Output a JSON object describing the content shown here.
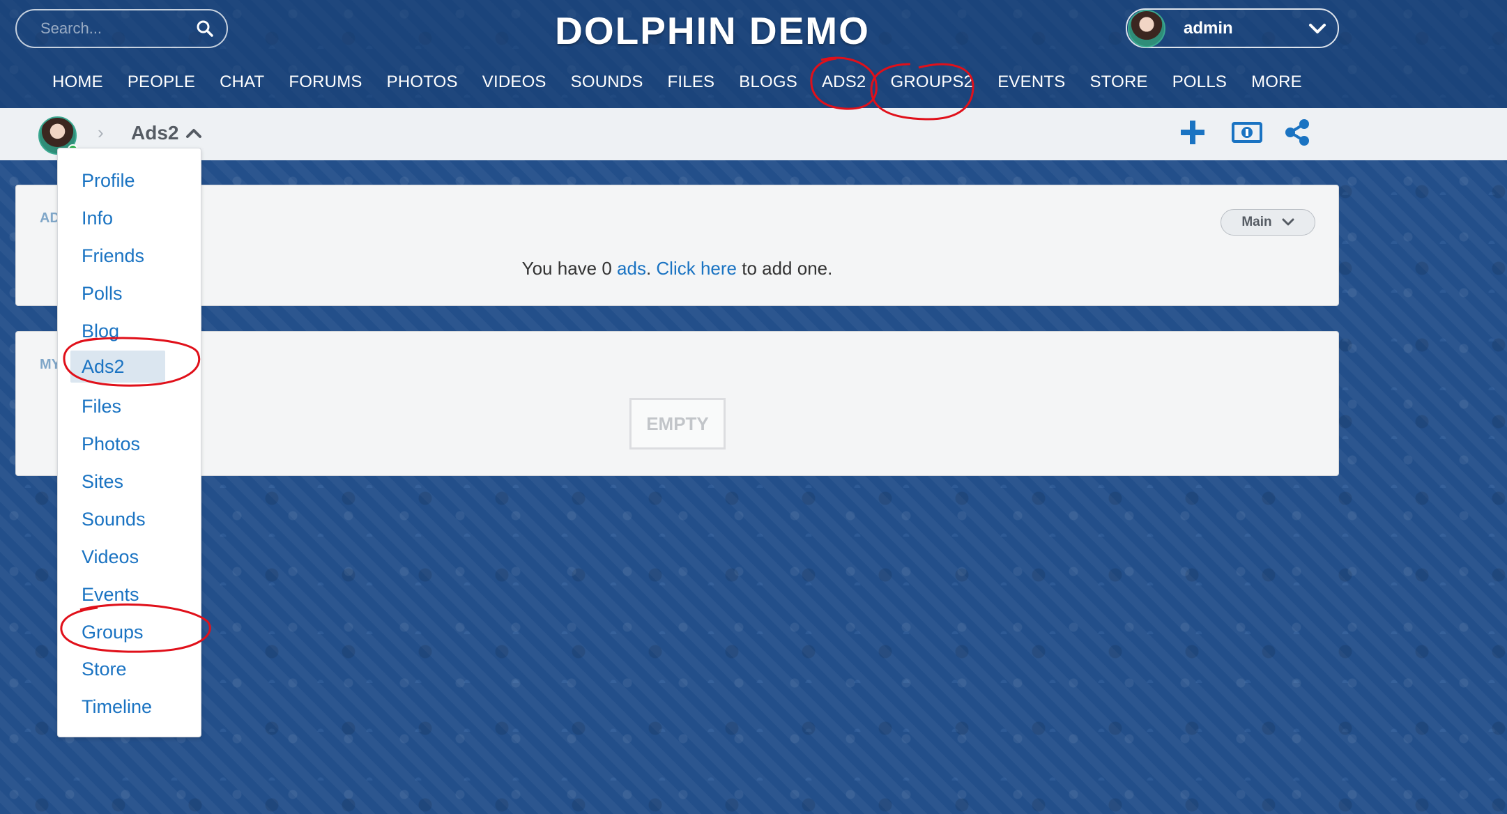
{
  "header": {
    "search_placeholder": "Search...",
    "site_title": "DOLPHIN DEMO",
    "account_name": "admin"
  },
  "main_nav": [
    "HOME",
    "PEOPLE",
    "CHAT",
    "FORUMS",
    "PHOTOS",
    "VIDEOS",
    "SOUNDS",
    "FILES",
    "BLOGS",
    "ADS2",
    "GROUPS2",
    "EVENTS",
    "STORE",
    "POLLS",
    "MORE"
  ],
  "breadcrumb": {
    "separator": "›",
    "current": "Ads2"
  },
  "panels": {
    "ads": {
      "title": "AD",
      "dropdown_label": "Main",
      "msg_prefix": "You have 0 ",
      "msg_ads_link": "ads",
      "msg_mid": ". ",
      "msg_click_link": "Click here",
      "msg_suffix": " to add one."
    },
    "my": {
      "title": "MY",
      "empty_label": "EMPTY"
    }
  },
  "profile_menu": {
    "items": [
      "Profile",
      "Info",
      "Friends",
      "Polls",
      "Blog",
      "Ads2",
      "Files",
      "Photos",
      "Sites",
      "Sounds",
      "Videos",
      "Events",
      "Groups",
      "Store",
      "Timeline"
    ],
    "active": "Ads2"
  },
  "colors": {
    "accent": "#1a73c2",
    "annotation": "#e0101a",
    "background": "#234f8a"
  },
  "icons": [
    "search-icon",
    "chevron-down-icon",
    "chevron-up-icon",
    "plus-icon",
    "money-icon",
    "share-icon"
  ]
}
